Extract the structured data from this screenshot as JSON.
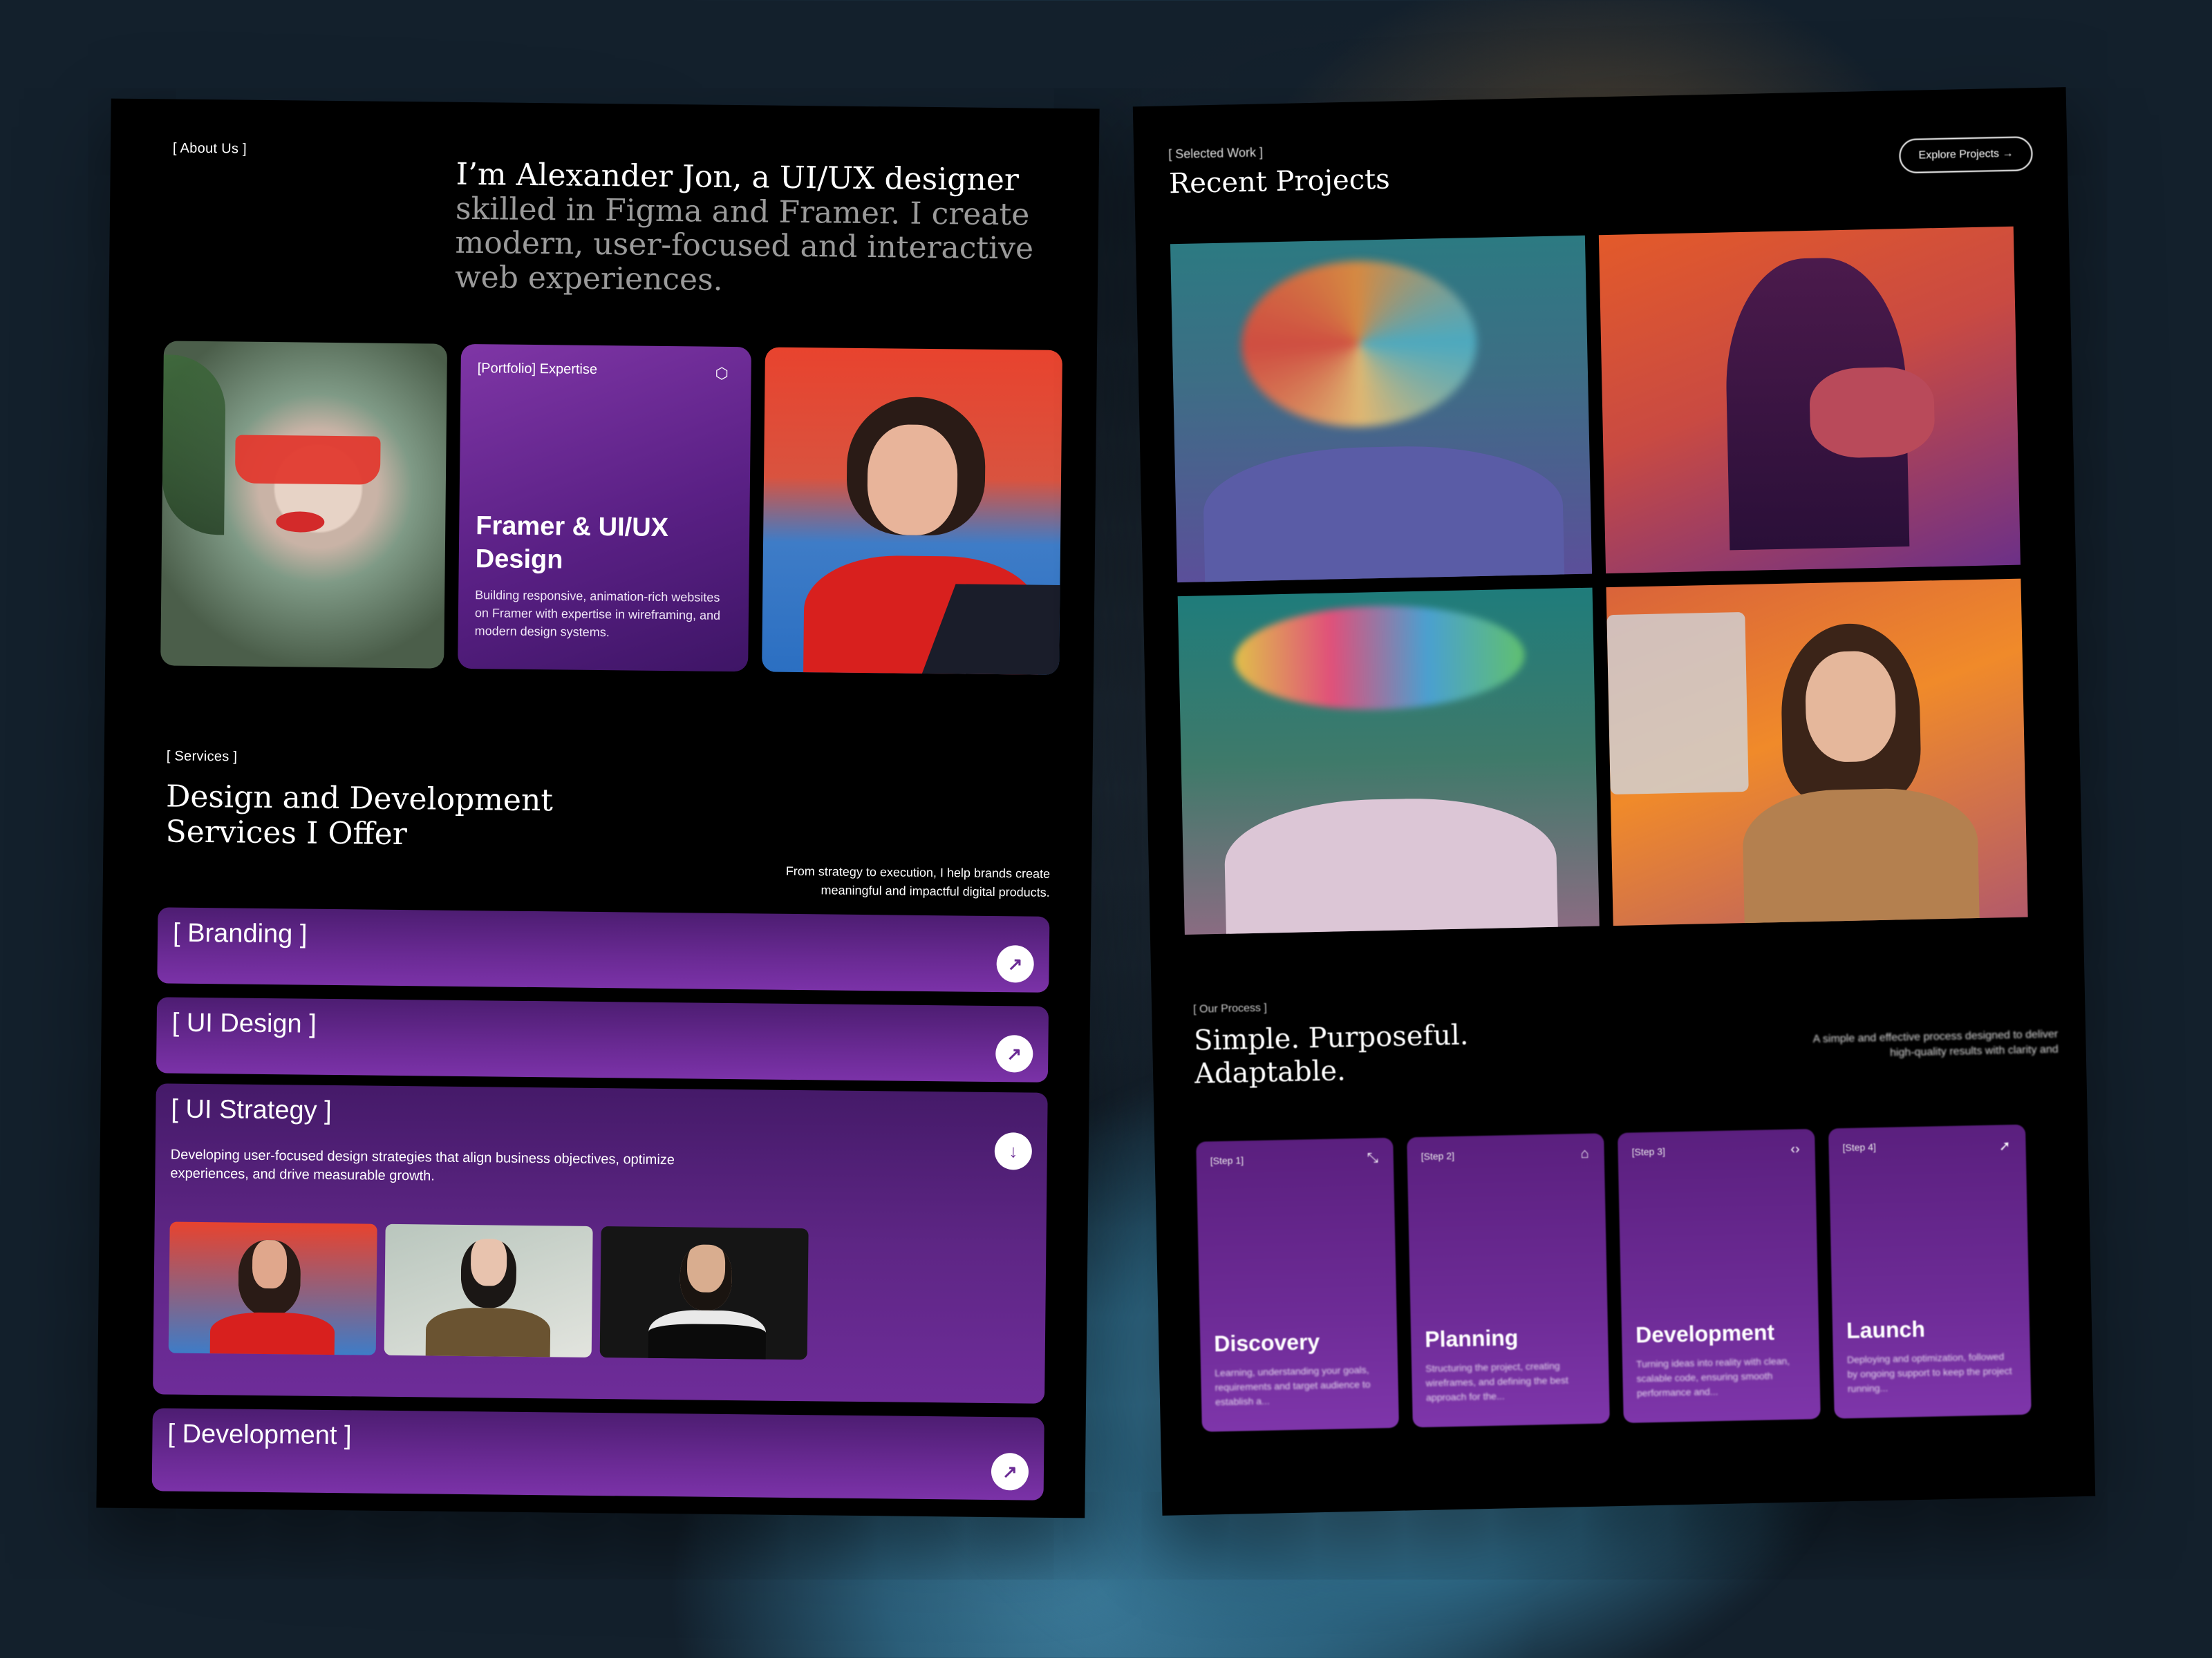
{
  "left_panel": {
    "about_tag": "[ About Us ]",
    "headline_strong": "I’m Alexander Jon, a UI/UX designer",
    "headline_rest": " skilled in Figma and Framer. I create modern, user-focused and interactive web experiences.",
    "expertise_card": {
      "tag": "[Portfolio] Expertise",
      "icon": "cube-icon",
      "title": "Framer & UI/UX Design",
      "description": "Building responsive, animation-rich websites on Framer with expertise in wireframing, and modern design systems."
    },
    "services_tag": "[ Services ]",
    "services_title": "Design and Development Services I Offer",
    "services_desc": "From strategy to execution, I help brands create meaningful and impactful digital products.",
    "services": [
      {
        "label": "[ Branding ]",
        "icon": "arrow-up-right-icon"
      },
      {
        "label": "[ UI Design ]",
        "icon": "arrow-up-right-icon"
      },
      {
        "label": "[ UI Strategy ]",
        "icon": "arrow-down-icon",
        "description": "Developing user-focused design strategies that align business objectives, optimize experiences, and drive measurable growth."
      },
      {
        "label": "[ Development ]",
        "icon": "arrow-up-right-icon"
      }
    ],
    "icon_glyphs": {
      "arrow_up_right": "↗",
      "arrow_down": "↓",
      "cube": "⬡"
    }
  },
  "right_panel": {
    "work_tag": "[ Selected Work ]",
    "title": "Recent Projects",
    "all_projects_button": "Explore Projects →",
    "process_tag": "[ Our Process ]",
    "process_title": "Simple. Purposeful. Adaptable.",
    "process_desc": "A simple and effective process designed to deliver high-quality results with clarity and",
    "steps": [
      {
        "tag": "[Step 1]",
        "icon": "expand-icon",
        "name": "Discovery",
        "description": "Learning, understanding your goals, requirements and target audience to establish a..."
      },
      {
        "tag": "[Step 2]",
        "icon": "bookmark-icon",
        "name": "Planning",
        "description": "Structuring the project, creating wireframes, and defining the best approach for the..."
      },
      {
        "tag": "[Step 3]",
        "icon": "code-icon",
        "name": "Development",
        "description": "Turning ideas into reality with clean, scalable code, ensuring smooth performance and..."
      },
      {
        "tag": "[Step 4]",
        "icon": "launch-icon",
        "name": "Launch",
        "description": "Deploying and optimization, followed by ongoing support to keep the project running..."
      }
    ],
    "step_glyphs": [
      "⤡",
      "⌂",
      "‹›",
      "➚"
    ]
  }
}
